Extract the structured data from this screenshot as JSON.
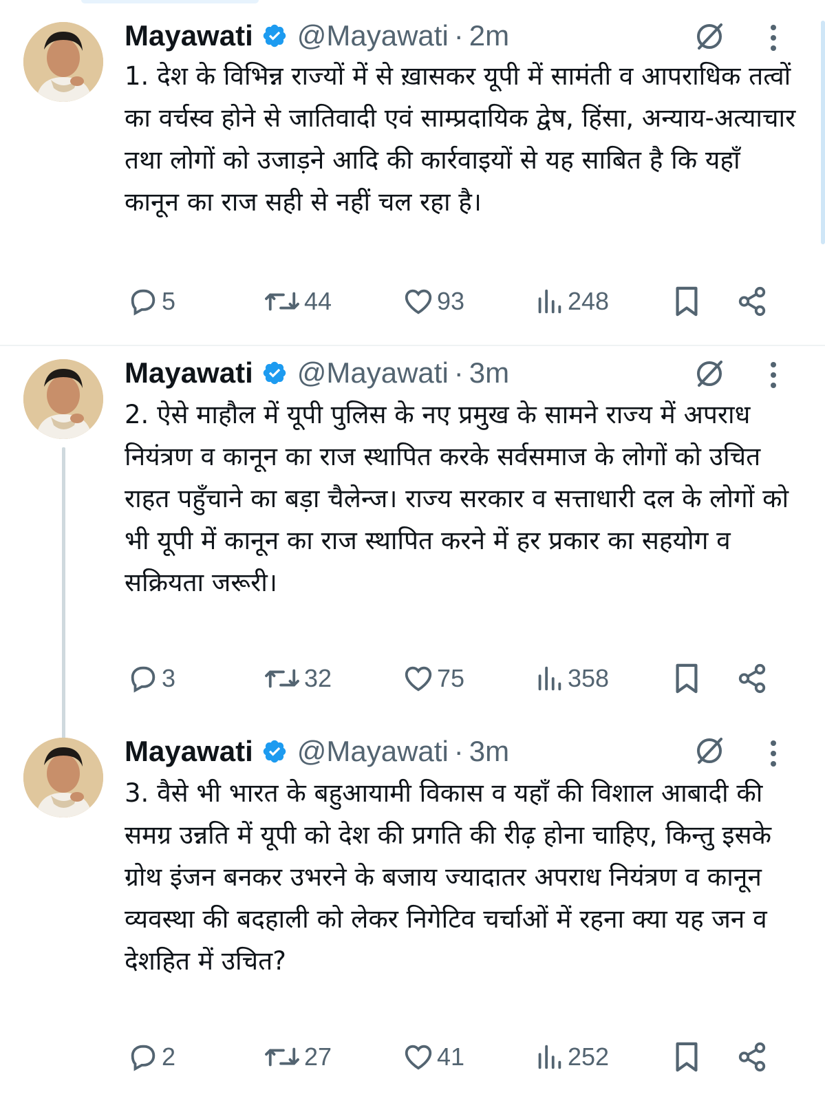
{
  "tweets": [
    {
      "name": "Mayawati",
      "handle": "@Mayawati",
      "separator": "·",
      "time": "2m",
      "text": "1. देश के विभिन्न राज्यों में से ख़ासकर यूपी में सामंती व आपराधिक तत्वों का वर्चस्व होने से जातिवादी एवं साम्प्रदायिक द्वेष, हिंसा,  अन्याय-अत्याचार तथा लोगों को उजाड़ने आदि की कार्रवाइयों से यह साबित है कि यहाँ कानून का राज सही से नहीं चल रहा है।",
      "replies": "5",
      "reposts": "44",
      "likes": "93",
      "views": "248"
    },
    {
      "name": "Mayawati",
      "handle": "@Mayawati",
      "separator": "·",
      "time": "3m",
      "text": "2. ऐसे माहौल में यूपी पुलिस के नए प्रमुख के सामने राज्य में अपराध नियंत्रण व कानून का राज स्थापित करके सर्वसमाज के लोगों को उचित राहत पहुँचाने का बड़ा चैलेन्ज। राज्य सरकार व सत्ताधारी दल के लोगों को भी यूपी में कानून का राज स्थापित करने में हर प्रकार का सहयोग व सक्रियता जरूरी।",
      "replies": "3",
      "reposts": "32",
      "likes": "75",
      "views": "358"
    },
    {
      "name": "Mayawati",
      "handle": "@Mayawati",
      "separator": "·",
      "time": "3m",
      "text": "3. वैसे भी भारत के बहुआयामी विकास व यहाँ की विशाल आबादी की समग्र उन्नति में यूपी को देश की प्रगति की रीढ़ होना चाहिए, किन्तु इसके ग्रोथ इंजन बनकर उभरने के बजाय ज्यादातर अपराध नियंत्रण व कानून व्यवस्था की बदहाली को लेकर निगेटिव चर्चाओं में रहना क्या यह जन व देशहित में उचित?",
      "replies": "2",
      "reposts": "27",
      "likes": "41",
      "views": "252"
    }
  ],
  "icons": {
    "verified": "verified-badge-icon",
    "grok": "grok-icon",
    "more": "more-options-icon",
    "reply": "reply-icon",
    "repost": "repost-icon",
    "like": "like-icon",
    "views": "views-icon",
    "bookmark": "bookmark-icon",
    "share": "share-icon"
  },
  "colors": {
    "text": "#0f1419",
    "secondary": "#536471",
    "verified": "#1d9bf0",
    "thread_line": "#cfd9de"
  }
}
